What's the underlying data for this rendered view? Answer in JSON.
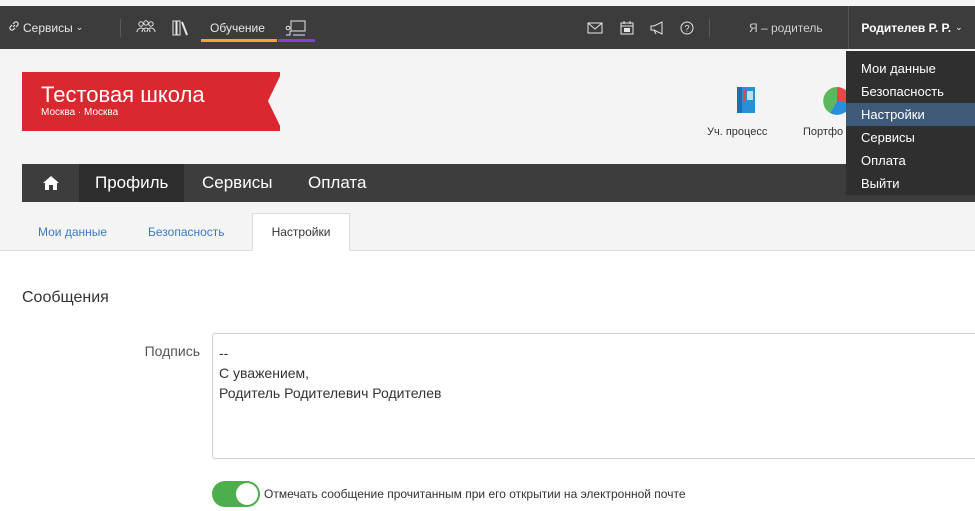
{
  "topbar": {
    "services_label": "Сервисы",
    "learning_label": "Обучение",
    "role_label": "Я – родитель",
    "user_label": "Родителев Р. Р."
  },
  "header": {
    "school_name": "Тестовая школа",
    "school_city": "Москва · Москва",
    "link_process": "Уч. процесс",
    "link_portfolio": "Портфо"
  },
  "nav": {
    "items": [
      "Профиль",
      "Сервисы",
      "Оплата"
    ]
  },
  "tabs": [
    "Мои данные",
    "Безопасность",
    "Настройки"
  ],
  "content": {
    "section_title": "Сообщения",
    "signature_label": "Подпись",
    "signature_value": "--\nС уважением,\nРодитель Родителевич Родителев",
    "toggle_label": "Отмечать сообщение прочитанным при его открытии на электронной почте",
    "toggle_on": true
  },
  "dropdown": {
    "items": [
      "Мои данные",
      "Безопасность",
      "Настройки",
      "Сервисы",
      "Оплата",
      "Выйти"
    ],
    "highlighted_index": 2
  },
  "colors": {
    "brand_red": "#d9282f",
    "topbar": "#3c3c3c",
    "toggle_green": "#4cae4c",
    "link_blue": "#3a7abf"
  }
}
